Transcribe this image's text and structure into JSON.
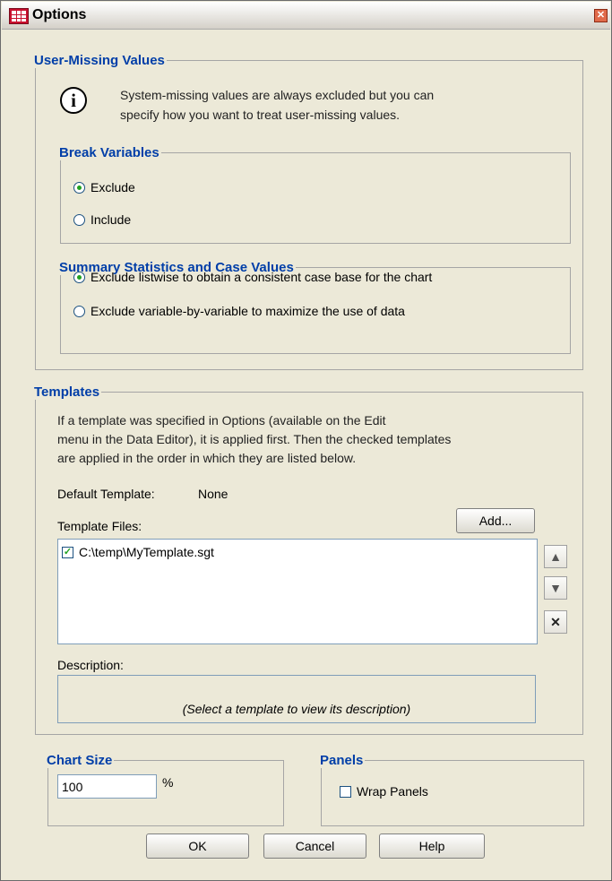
{
  "window": {
    "title": "Options",
    "icon": "table-grid-icon"
  },
  "user_missing": {
    "legend": "User-Missing Values",
    "info_line1": "System-missing values are always excluded but you can",
    "info_line2": "specify how you want to treat user-missing values.",
    "break_variables": {
      "legend": "Break Variables",
      "options": [
        {
          "label": "Exclude",
          "checked": true
        },
        {
          "label": "Include",
          "checked": false
        }
      ]
    },
    "summary_statistics": {
      "legend": "Summary Statistics and Case Values",
      "options": [
        {
          "label": "Exclude listwise to obtain a consistent case base for the chart",
          "checked": true
        },
        {
          "label": "Exclude variable-by-variable to maximize the use of data",
          "checked": false
        }
      ]
    }
  },
  "templates": {
    "legend": "Templates",
    "info_line1": "If a template was specified in Options (available on the Edit",
    "info_line2": "menu in the Data Editor), it is applied first. Then the checked templates",
    "info_line3": "are applied in the order in which they are listed below.",
    "default_template_label": "Default Template:",
    "default_template_value": "None",
    "template_files_label": "Template Files:",
    "add_button": "Add...",
    "files": [
      {
        "name": "C:\\temp\\MyTemplate.sgt",
        "checked": true
      }
    ],
    "move_up_icon": "arrow-up-icon",
    "move_down_icon": "arrow-down-icon",
    "remove_icon": "x-delete-icon",
    "description_label": "Description:",
    "description_placeholder": "(Select a template to view its description)"
  },
  "chart_size": {
    "legend": "Chart Size",
    "value": "100",
    "unit": "%"
  },
  "panels": {
    "legend": "Panels",
    "wrap_label": "Wrap Panels",
    "wrap_checked": false
  },
  "buttons": {
    "ok": "OK",
    "cancel": "Cancel",
    "help": "Help"
  },
  "colors": {
    "legend_text": "#003ea8",
    "radio_checked": "#21a121",
    "dialog_bg": "#ece9d8"
  }
}
